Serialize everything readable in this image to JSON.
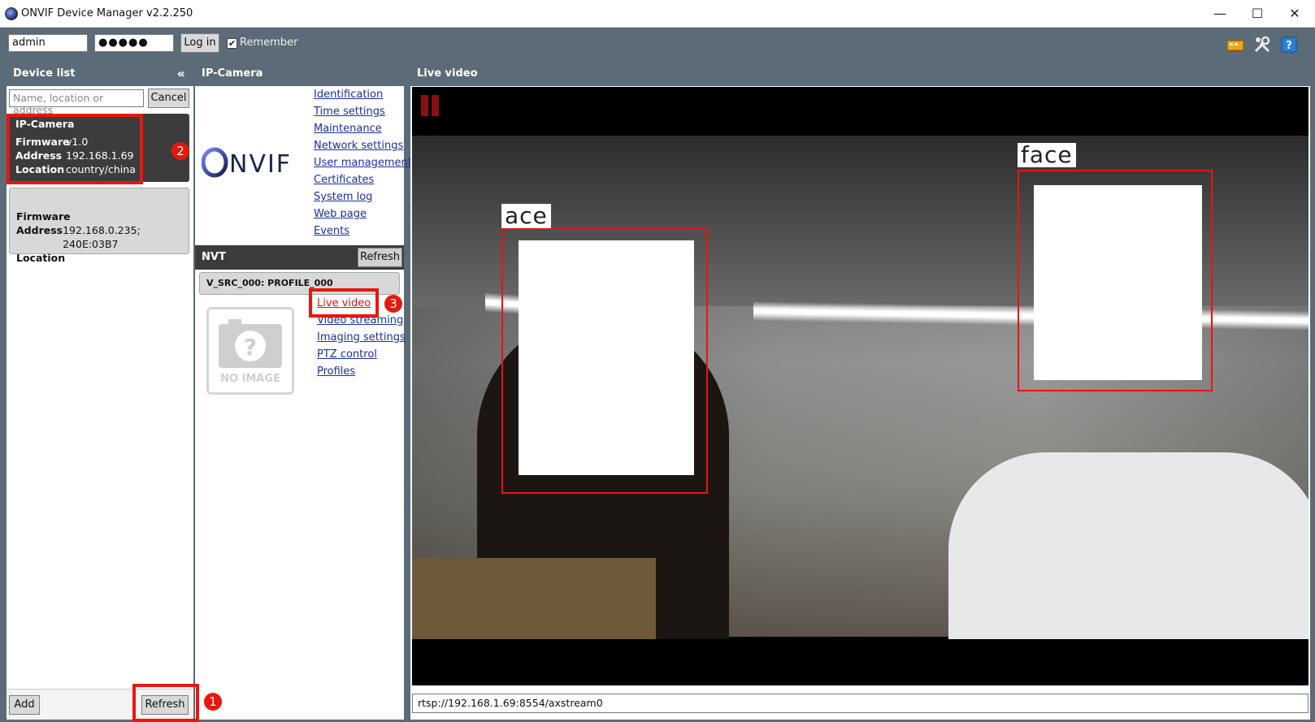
{
  "window": {
    "title": "ONVIF Device Manager v2.2.250",
    "controls": {
      "minimize": "—",
      "maximize": "☐",
      "close": "✕"
    }
  },
  "login": {
    "username": "admin",
    "password": "●●●●●",
    "login_label": "Log in",
    "remember_label": "Remember",
    "remember_checked": true
  },
  "toolbar_icons": [
    "network-adapter-icon",
    "tools-icon",
    "help-icon"
  ],
  "device_list": {
    "title": "Device list",
    "collapse_glyph": "«",
    "search_placeholder": "Name, location or address",
    "cancel_label": "Cancel",
    "devices": [
      {
        "name": "IP-Camera",
        "firmware_key": "Firmware",
        "firmware": "v1.0",
        "address_key": "Address",
        "address": "192.168.1.69",
        "location_key": "Location",
        "location": "country/china",
        "selected": true
      },
      {
        "name": "",
        "firmware_key": "Firmware",
        "firmware": "",
        "address_key": "Address",
        "address": "192.168.0.235; 240E:03B7",
        "location_key": "Location",
        "location": "",
        "selected": false
      }
    ],
    "add_label": "Add",
    "refresh_label": "Refresh"
  },
  "camera_panel": {
    "title": "IP-Camera",
    "logo_text": "ONVIF",
    "links": [
      "Identification",
      "Time settings",
      "Maintenance",
      "Network settings",
      "User management",
      "Certificates",
      "System log",
      "Web page",
      "Events"
    ],
    "nvt_title": "NVT",
    "nvt_refresh_label": "Refresh",
    "profile": "V_SRC_000: PROFILE_000",
    "no_image_label": "NO IMAGE",
    "profile_links": [
      "Live video",
      "Video streaming",
      "Imaging settings",
      "PTZ control",
      "Profiles"
    ]
  },
  "live_video": {
    "title": "Live video",
    "face_labels": [
      "ace",
      "face"
    ],
    "stream_url": "rtsp://192.168.1.69:8554/axstream0"
  },
  "annotations": [
    "1",
    "2",
    "3"
  ],
  "colors": {
    "panel_header": "#5b6b78",
    "selected_card": "#3c3c3c",
    "link": "#1a2fa0",
    "highlight": "#e8170e"
  }
}
